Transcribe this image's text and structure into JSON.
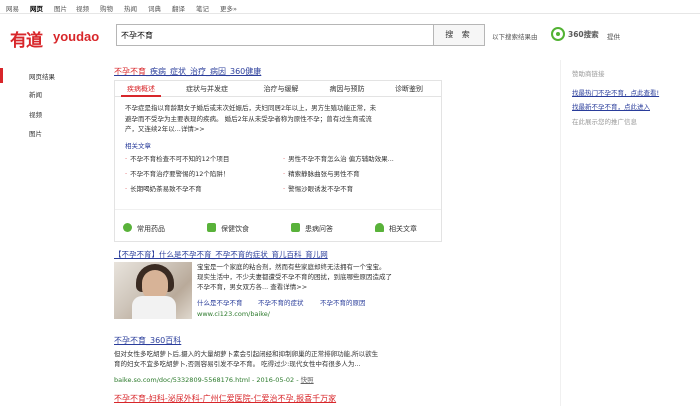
{
  "topnav": [
    "网易",
    "网页",
    "图片",
    "视频",
    "购物",
    "热闻",
    "词典",
    "翻译",
    "笔记",
    "更多»"
  ],
  "logo": {
    "cn": "有道",
    "en": "youdao"
  },
  "search": {
    "value": "不孕不育",
    "button": "搜 索"
  },
  "provider": {
    "prefix": "以下搜索结果由",
    "name": "360搜索",
    "suffix": "提供"
  },
  "left_nav": [
    "网页结果",
    "新闻",
    "视频",
    "图片"
  ],
  "result1": {
    "title_parts": [
      "不孕不育",
      "_疾病_症状_治疗_病因_360健康"
    ],
    "tabs": [
      "疾病概述",
      "症状与并发症",
      "治疗与缓解",
      "病因与预防",
      "诊断鉴别"
    ],
    "desc_lines": [
      "不孕症是指以育龄期女子婚后或末次妊娠后，夫妇同居2年以上，男方生殖功能正常，未",
      "避孕而不受孕为主要表现的疾病。 婚后2年从未受孕者称为原性不孕；曾有过生育或流",
      "产，又连续2年以...详情>>"
    ],
    "related_label": "相关文章",
    "links": [
      "不孕不育检查不可不知的12个项目",
      "男性不孕不育怎么治 偏方辅助效果...",
      "不孕不育治疗要警惕的12个陷阱！",
      "精索静脉曲张与男性不育",
      "长期喝奶茶易致不孕不育",
      "警惕沙眼诱发不孕不育"
    ],
    "icons": [
      "常用药品",
      "保健饮食",
      "患病问答",
      "相关文章"
    ]
  },
  "result2": {
    "title": "【不孕不育】什么是不孕不育_不孕不育的症状_育儿百科_育儿网",
    "snip": [
      "宝宝是一个家庭的粘合剂，然而有些家庭却终无法拥有一个宝宝。",
      "现实生活中，不少夫妻都遭受不孕不育的困扰，到底哪些原因造成了",
      "不孕不育，男女双方各... 查看详情>>"
    ],
    "links": [
      "什么是不孕不育",
      "不孕不育的症状",
      "不孕不育的原因"
    ],
    "url": "www.ci123.com/baike/"
  },
  "result3": {
    "title": "不孕不育_360百科",
    "snip": [
      "但对女性多吃胡萝卜后,摄入的大量胡萝卜素会引起闭经和抑制卵巢的正常排卵功能,所以欲生",
      "育的妇女不宜多吃胡萝卜,否则容易引发不孕不育。 吃得过少:现代女性中有很多人为..."
    ],
    "url": "baike.so.com/doc/5332809-5568176.html - 2016-05-02 - ",
    "cache": "快照"
  },
  "result4": {
    "title": "不孕不育-妇科-泌尿外科-广州仁爱医院-仁爱治不孕,报喜千万家"
  },
  "sidebar": {
    "heading": "赞助商链接",
    "links": [
      "找最热门不孕不育，点此查看!",
      "找最新不孕不育，点此进入"
    ],
    "promo": "在此展示您的推广信息"
  },
  "colors": {
    "brand": "#d8262a",
    "link": "#2a3d9b",
    "url": "#2c7a2c",
    "icon": "#59b23a"
  }
}
